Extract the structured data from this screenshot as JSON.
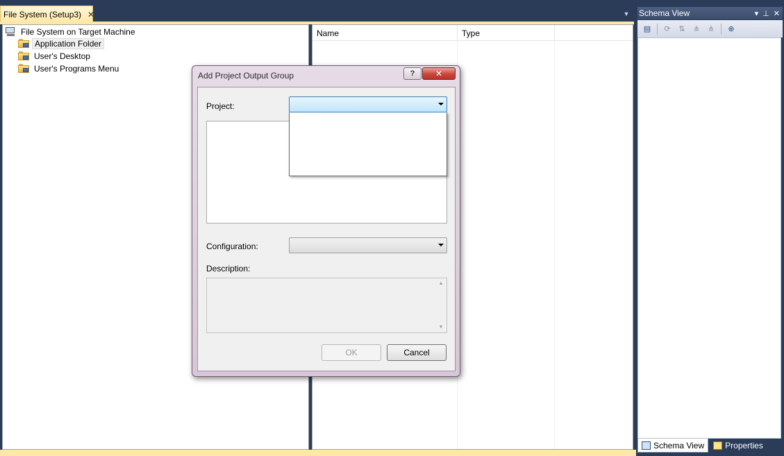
{
  "document_tab": {
    "label": "File System (Setup3)",
    "close": "✕",
    "menu": "▼"
  },
  "tree": {
    "root": "File System on Target Machine",
    "items": [
      {
        "label": "Application Folder",
        "selected": true
      },
      {
        "label": "User's Desktop",
        "selected": false
      },
      {
        "label": "User's Programs Menu",
        "selected": false
      }
    ]
  },
  "list": {
    "columns": [
      "Name",
      "Type"
    ]
  },
  "schema_panel": {
    "title": "Schema View",
    "title_buttons": [
      "▾",
      "⊥",
      "✕"
    ],
    "toolbar_icons": [
      "tree-view-icon",
      "refresh-icon",
      "sort-icon",
      "hierarchy-icon",
      "hierarchy-alt-icon",
      "zoom-icon"
    ],
    "tabs": [
      {
        "label": "Schema View",
        "active": true
      },
      {
        "label": "Properties",
        "active": false
      }
    ]
  },
  "dialog": {
    "title": "Add Project Output Group",
    "help": "?",
    "close": "✕",
    "project_label": "Project:",
    "project_value": "",
    "configuration_label": "Configuration:",
    "configuration_value": "",
    "description_label": "Description:",
    "ok": "OK",
    "cancel": "Cancel"
  },
  "colors": {
    "chrome": "#2b3c59",
    "tab_accent": "#ffe8a6",
    "combo_focus": "#bee6fd",
    "close_red": "#c9463a"
  }
}
